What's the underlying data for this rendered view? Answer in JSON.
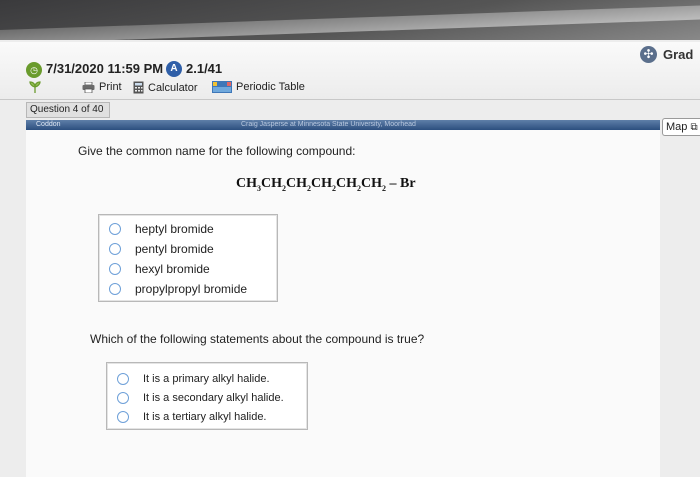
{
  "header": {
    "deadline": "7/31/2020 11:59 PM",
    "attempt_badge": "A",
    "attempt_count": "2.1/41",
    "tools": {
      "print": "Print",
      "calculator": "Calculator",
      "periodic": "Periodic Table"
    },
    "grade": "Grad"
  },
  "question_bar": {
    "label": "Question 4 of 40"
  },
  "map_button": "Map",
  "tab": {
    "label": "Coddon",
    "credit": "Craig Jasperse at Minnesota State University, Moorhead"
  },
  "question1": {
    "prompt": "Give the common name for the following compound:",
    "formula": {
      "segments": [
        "CH",
        "3",
        "CH",
        "2",
        "CH",
        "2",
        "CH",
        "2",
        "CH",
        "2",
        "CH",
        "2"
      ],
      "tail": " – Br"
    },
    "choices": [
      "heptyl bromide",
      "pentyl bromide",
      "hexyl bromide",
      "propylpropyl bromide"
    ]
  },
  "question2": {
    "prompt": "Which of the following statements about the compound is true?",
    "choices": [
      "It is a primary alkyl halide.",
      "It is a secondary alkyl halide.",
      "It is a tertiary alkyl halide."
    ]
  },
  "colors": {
    "radio_border": "#6ea0d8",
    "tab_strip": "#2c4f7f",
    "clock": "#6a9b2d",
    "badge": "#2f5fa8"
  }
}
